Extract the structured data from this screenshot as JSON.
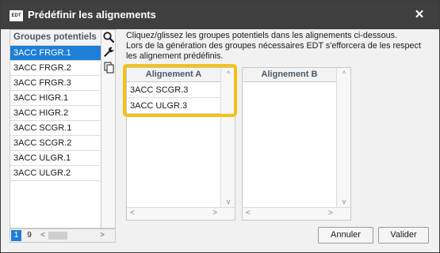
{
  "window": {
    "title": "Prédéfinir les alignements",
    "app_icon_text": "EDT",
    "close_symbol": "✕"
  },
  "groups_list": {
    "header": "Groupes potentiels",
    "items": [
      {
        "label": "3ACC FRGR.1",
        "selected": true
      },
      {
        "label": "3ACC FRGR.2",
        "selected": false
      },
      {
        "label": "3ACC FRGR.3",
        "selected": false
      },
      {
        "label": "3ACC HIGR.1",
        "selected": false
      },
      {
        "label": "3ACC HIGR.2",
        "selected": false
      },
      {
        "label": "3ACC SCGR.1",
        "selected": false
      },
      {
        "label": "3ACC SCGR.2",
        "selected": false
      },
      {
        "label": "3ACC ULGR.1",
        "selected": false
      },
      {
        "label": "3ACC ULGR.2",
        "selected": false
      }
    ],
    "footer": {
      "current_page": "1",
      "other_page": "9",
      "scroll_left": "<",
      "scroll_right": ">"
    }
  },
  "toolbar": {
    "icons": [
      "search-icon",
      "wrench-icon",
      "copy-icon"
    ]
  },
  "instructions": {
    "line1": "Cliquez/glissez les groupes potentiels dans les alignements ci-dessous.",
    "line2": "Lors de la génération des groupes nécessaires EDT s'efforcera de les respect",
    "line3": "les alignement prédéfinis."
  },
  "alignment_a": {
    "header": "Alignement  A",
    "rows": [
      "3ACC SCGR.3",
      "3ACC ULGR.3"
    ]
  },
  "alignment_b": {
    "header": "Alignement  B",
    "rows": []
  },
  "scroll_glyphs": {
    "up": "^",
    "down": "v",
    "left": "<",
    "right": ">"
  },
  "buttons": {
    "cancel": "Annuler",
    "validate": "Valider"
  },
  "colors": {
    "titlebar": "#3f3f3f",
    "selection": "#1e7fd6",
    "highlight": "#f3c218"
  }
}
